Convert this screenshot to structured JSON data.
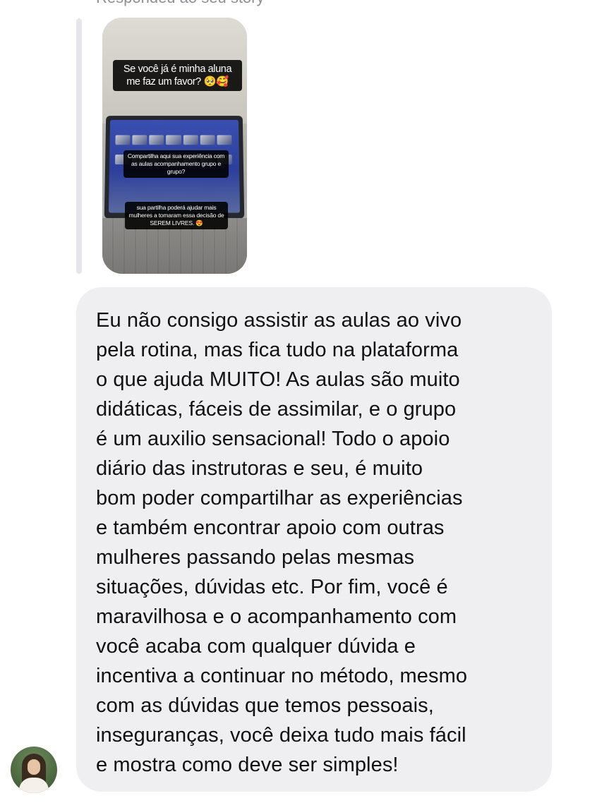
{
  "thread": {
    "reply_caption": "Respondeu ao seu story"
  },
  "story": {
    "headline": "Se você já é minha aluna me faz um favor? 🥺🥰",
    "middle_text": "Compartilha aqui sua experiência com as aulas acompanhamento grupo e grupo?",
    "bottom_text": "sua partilha poderá ajudar mais mulheres a tomaram essa decisão de SEREM LIVRES. 😍"
  },
  "message": {
    "text": "Eu não consigo assistir as aulas ao vivo\npela rotina, mas fica tudo na plataforma\no que ajuda MUITO! As aulas são muito\ndidáticas, fáceis de assimilar, e o grupo\né um auxilio sensacional! Todo o apoio\ndiário das instrutoras e seu, é muito\nbom poder compartilhar as experiências\ne também encontrar apoio com outras\nmulheres passando pelas mesmas\nsituações, dúvidas etc. Por fim, você é\nmaravilhosa e o acompanhamento com\nvocê acaba com qualquer dúvida e\nincentiva a continuar no método, mesmo\ncom as dúvidas que temos pessoais,\ninseguranças, você deixa tudo mais fácil\ne mostra como deve ser simples!"
  },
  "colors": {
    "bubble_background": "#efeff1",
    "reply_bar": "#e5e6ea",
    "caption_gray": "#8e8e93",
    "text": "#111111"
  }
}
